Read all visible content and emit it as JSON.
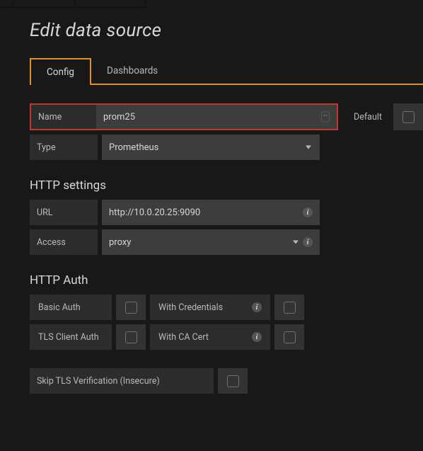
{
  "page_title": "Edit data source",
  "tabs": {
    "config": "Config",
    "dashboards": "Dashboards"
  },
  "fields": {
    "name_label": "Name",
    "name_value": "prom25",
    "default_label": "Default",
    "type_label": "Type",
    "type_value": "Prometheus"
  },
  "http_settings": {
    "heading": "HTTP settings",
    "url_label": "URL",
    "url_value": "http://10.0.20.25:9090",
    "access_label": "Access",
    "access_value": "proxy"
  },
  "http_auth": {
    "heading": "HTTP Auth",
    "basic_auth": "Basic Auth",
    "with_credentials": "With Credentials",
    "tls_client_auth": "TLS Client Auth",
    "with_ca_cert": "With CA Cert",
    "skip_tls": "Skip TLS Verification (Insecure)"
  }
}
